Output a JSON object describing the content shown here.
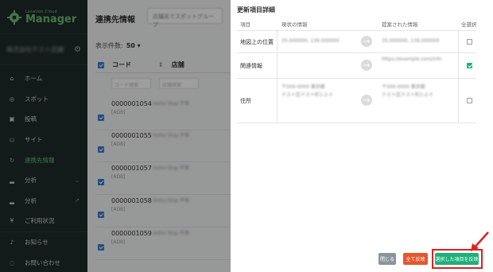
{
  "sidebar": {
    "logo_small": "Location Cloud",
    "logo_big": "Manager",
    "account_name": "株式会社テスト店舗",
    "items": [
      {
        "label": "ホーム",
        "icon": "home-icon"
      },
      {
        "label": "スポット",
        "icon": "pin-icon"
      },
      {
        "label": "投稿",
        "icon": "post-icon"
      },
      {
        "label": "サイト",
        "icon": "site-icon"
      },
      {
        "label": "連携先情報",
        "icon": "sync-icon",
        "active": true
      },
      {
        "label": "分析",
        "icon": "chart-icon",
        "trail": "⌄"
      },
      {
        "label": "分析",
        "icon": "chart-icon",
        "trail": "↗"
      },
      {
        "label": "ご利用状況",
        "icon": "yen-icon"
      },
      {
        "label": "お知らせ",
        "icon": "bell-icon"
      },
      {
        "label": "お問い合わせ",
        "icon": "contact-icon"
      }
    ]
  },
  "main": {
    "title": "連携先情報",
    "top_select": "店舗名でスポットグループ",
    "count_label": "表示件数:",
    "count_value": "50 ▾",
    "col_code": "コード",
    "col_store": "店舗",
    "filter_code": "コード検索",
    "filter_store": "店舗検索",
    "rows": [
      {
        "code": "0000001054",
        "sub": "[ADB]",
        "blur": "Hotto Stop 平塚"
      },
      {
        "code": "0000001055",
        "sub": "[ADB]",
        "blur": "Hotto Stop 平塚"
      },
      {
        "code": "0000001057",
        "sub": "[ADB]",
        "blur": "Hotto Stop 平塚"
      },
      {
        "code": "0000001058",
        "sub": "[ADB]",
        "blur": "Hotto Stop 平塚"
      },
      {
        "code": "0000001059",
        "sub": "[ADB]",
        "blur": "Hotto Stop 平塚"
      }
    ]
  },
  "panel": {
    "title": "更新項目詳細",
    "headers": {
      "item": "項目",
      "current": "現状の情報",
      "proposed": "提案された情報",
      "select_all": "全選択"
    },
    "rows": [
      {
        "label": "地図上の位置",
        "current": "35.000000, 139.000000",
        "proposed": "35.000000, 139.000000",
        "checked": false
      },
      {
        "label": "関連情報",
        "current": "",
        "proposed": "https://example.com/info",
        "checked": true
      },
      {
        "label": "住所",
        "current": "〒000-0000 東京都\nテスト区テスト町1-2-3",
        "proposed": "〒000-0000 東京都\nテスト区テスト町1-2-3",
        "checked": false
      }
    ],
    "buttons": {
      "close": "閉じる",
      "reflect_all": "全て反映",
      "reflect_selected": "選択した項目を反映"
    }
  }
}
